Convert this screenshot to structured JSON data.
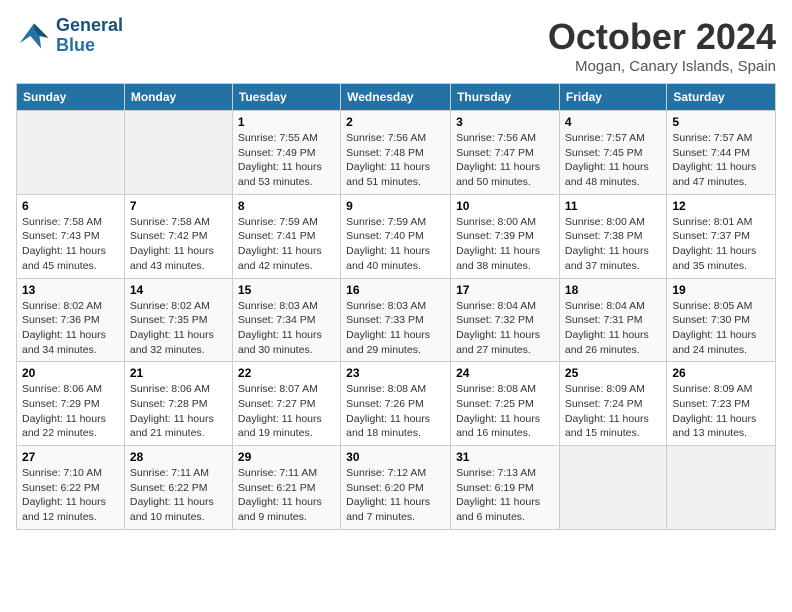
{
  "header": {
    "logo_line1": "General",
    "logo_line2": "Blue",
    "month": "October 2024",
    "location": "Mogan, Canary Islands, Spain"
  },
  "days_of_week": [
    "Sunday",
    "Monday",
    "Tuesday",
    "Wednesday",
    "Thursday",
    "Friday",
    "Saturday"
  ],
  "weeks": [
    [
      null,
      null,
      {
        "day": "1",
        "sunrise": "Sunrise: 7:55 AM",
        "sunset": "Sunset: 7:49 PM",
        "daylight": "Daylight: 11 hours and 53 minutes."
      },
      {
        "day": "2",
        "sunrise": "Sunrise: 7:56 AM",
        "sunset": "Sunset: 7:48 PM",
        "daylight": "Daylight: 11 hours and 51 minutes."
      },
      {
        "day": "3",
        "sunrise": "Sunrise: 7:56 AM",
        "sunset": "Sunset: 7:47 PM",
        "daylight": "Daylight: 11 hours and 50 minutes."
      },
      {
        "day": "4",
        "sunrise": "Sunrise: 7:57 AM",
        "sunset": "Sunset: 7:45 PM",
        "daylight": "Daylight: 11 hours and 48 minutes."
      },
      {
        "day": "5",
        "sunrise": "Sunrise: 7:57 AM",
        "sunset": "Sunset: 7:44 PM",
        "daylight": "Daylight: 11 hours and 47 minutes."
      }
    ],
    [
      {
        "day": "6",
        "sunrise": "Sunrise: 7:58 AM",
        "sunset": "Sunset: 7:43 PM",
        "daylight": "Daylight: 11 hours and 45 minutes."
      },
      {
        "day": "7",
        "sunrise": "Sunrise: 7:58 AM",
        "sunset": "Sunset: 7:42 PM",
        "daylight": "Daylight: 11 hours and 43 minutes."
      },
      {
        "day": "8",
        "sunrise": "Sunrise: 7:59 AM",
        "sunset": "Sunset: 7:41 PM",
        "daylight": "Daylight: 11 hours and 42 minutes."
      },
      {
        "day": "9",
        "sunrise": "Sunrise: 7:59 AM",
        "sunset": "Sunset: 7:40 PM",
        "daylight": "Daylight: 11 hours and 40 minutes."
      },
      {
        "day": "10",
        "sunrise": "Sunrise: 8:00 AM",
        "sunset": "Sunset: 7:39 PM",
        "daylight": "Daylight: 11 hours and 38 minutes."
      },
      {
        "day": "11",
        "sunrise": "Sunrise: 8:00 AM",
        "sunset": "Sunset: 7:38 PM",
        "daylight": "Daylight: 11 hours and 37 minutes."
      },
      {
        "day": "12",
        "sunrise": "Sunrise: 8:01 AM",
        "sunset": "Sunset: 7:37 PM",
        "daylight": "Daylight: 11 hours and 35 minutes."
      }
    ],
    [
      {
        "day": "13",
        "sunrise": "Sunrise: 8:02 AM",
        "sunset": "Sunset: 7:36 PM",
        "daylight": "Daylight: 11 hours and 34 minutes."
      },
      {
        "day": "14",
        "sunrise": "Sunrise: 8:02 AM",
        "sunset": "Sunset: 7:35 PM",
        "daylight": "Daylight: 11 hours and 32 minutes."
      },
      {
        "day": "15",
        "sunrise": "Sunrise: 8:03 AM",
        "sunset": "Sunset: 7:34 PM",
        "daylight": "Daylight: 11 hours and 30 minutes."
      },
      {
        "day": "16",
        "sunrise": "Sunrise: 8:03 AM",
        "sunset": "Sunset: 7:33 PM",
        "daylight": "Daylight: 11 hours and 29 minutes."
      },
      {
        "day": "17",
        "sunrise": "Sunrise: 8:04 AM",
        "sunset": "Sunset: 7:32 PM",
        "daylight": "Daylight: 11 hours and 27 minutes."
      },
      {
        "day": "18",
        "sunrise": "Sunrise: 8:04 AM",
        "sunset": "Sunset: 7:31 PM",
        "daylight": "Daylight: 11 hours and 26 minutes."
      },
      {
        "day": "19",
        "sunrise": "Sunrise: 8:05 AM",
        "sunset": "Sunset: 7:30 PM",
        "daylight": "Daylight: 11 hours and 24 minutes."
      }
    ],
    [
      {
        "day": "20",
        "sunrise": "Sunrise: 8:06 AM",
        "sunset": "Sunset: 7:29 PM",
        "daylight": "Daylight: 11 hours and 22 minutes."
      },
      {
        "day": "21",
        "sunrise": "Sunrise: 8:06 AM",
        "sunset": "Sunset: 7:28 PM",
        "daylight": "Daylight: 11 hours and 21 minutes."
      },
      {
        "day": "22",
        "sunrise": "Sunrise: 8:07 AM",
        "sunset": "Sunset: 7:27 PM",
        "daylight": "Daylight: 11 hours and 19 minutes."
      },
      {
        "day": "23",
        "sunrise": "Sunrise: 8:08 AM",
        "sunset": "Sunset: 7:26 PM",
        "daylight": "Daylight: 11 hours and 18 minutes."
      },
      {
        "day": "24",
        "sunrise": "Sunrise: 8:08 AM",
        "sunset": "Sunset: 7:25 PM",
        "daylight": "Daylight: 11 hours and 16 minutes."
      },
      {
        "day": "25",
        "sunrise": "Sunrise: 8:09 AM",
        "sunset": "Sunset: 7:24 PM",
        "daylight": "Daylight: 11 hours and 15 minutes."
      },
      {
        "day": "26",
        "sunrise": "Sunrise: 8:09 AM",
        "sunset": "Sunset: 7:23 PM",
        "daylight": "Daylight: 11 hours and 13 minutes."
      }
    ],
    [
      {
        "day": "27",
        "sunrise": "Sunrise: 7:10 AM",
        "sunset": "Sunset: 6:22 PM",
        "daylight": "Daylight: 11 hours and 12 minutes."
      },
      {
        "day": "28",
        "sunrise": "Sunrise: 7:11 AM",
        "sunset": "Sunset: 6:22 PM",
        "daylight": "Daylight: 11 hours and 10 minutes."
      },
      {
        "day": "29",
        "sunrise": "Sunrise: 7:11 AM",
        "sunset": "Sunset: 6:21 PM",
        "daylight": "Daylight: 11 hours and 9 minutes."
      },
      {
        "day": "30",
        "sunrise": "Sunrise: 7:12 AM",
        "sunset": "Sunset: 6:20 PM",
        "daylight": "Daylight: 11 hours and 7 minutes."
      },
      {
        "day": "31",
        "sunrise": "Sunrise: 7:13 AM",
        "sunset": "Sunset: 6:19 PM",
        "daylight": "Daylight: 11 hours and 6 minutes."
      },
      null,
      null
    ]
  ]
}
